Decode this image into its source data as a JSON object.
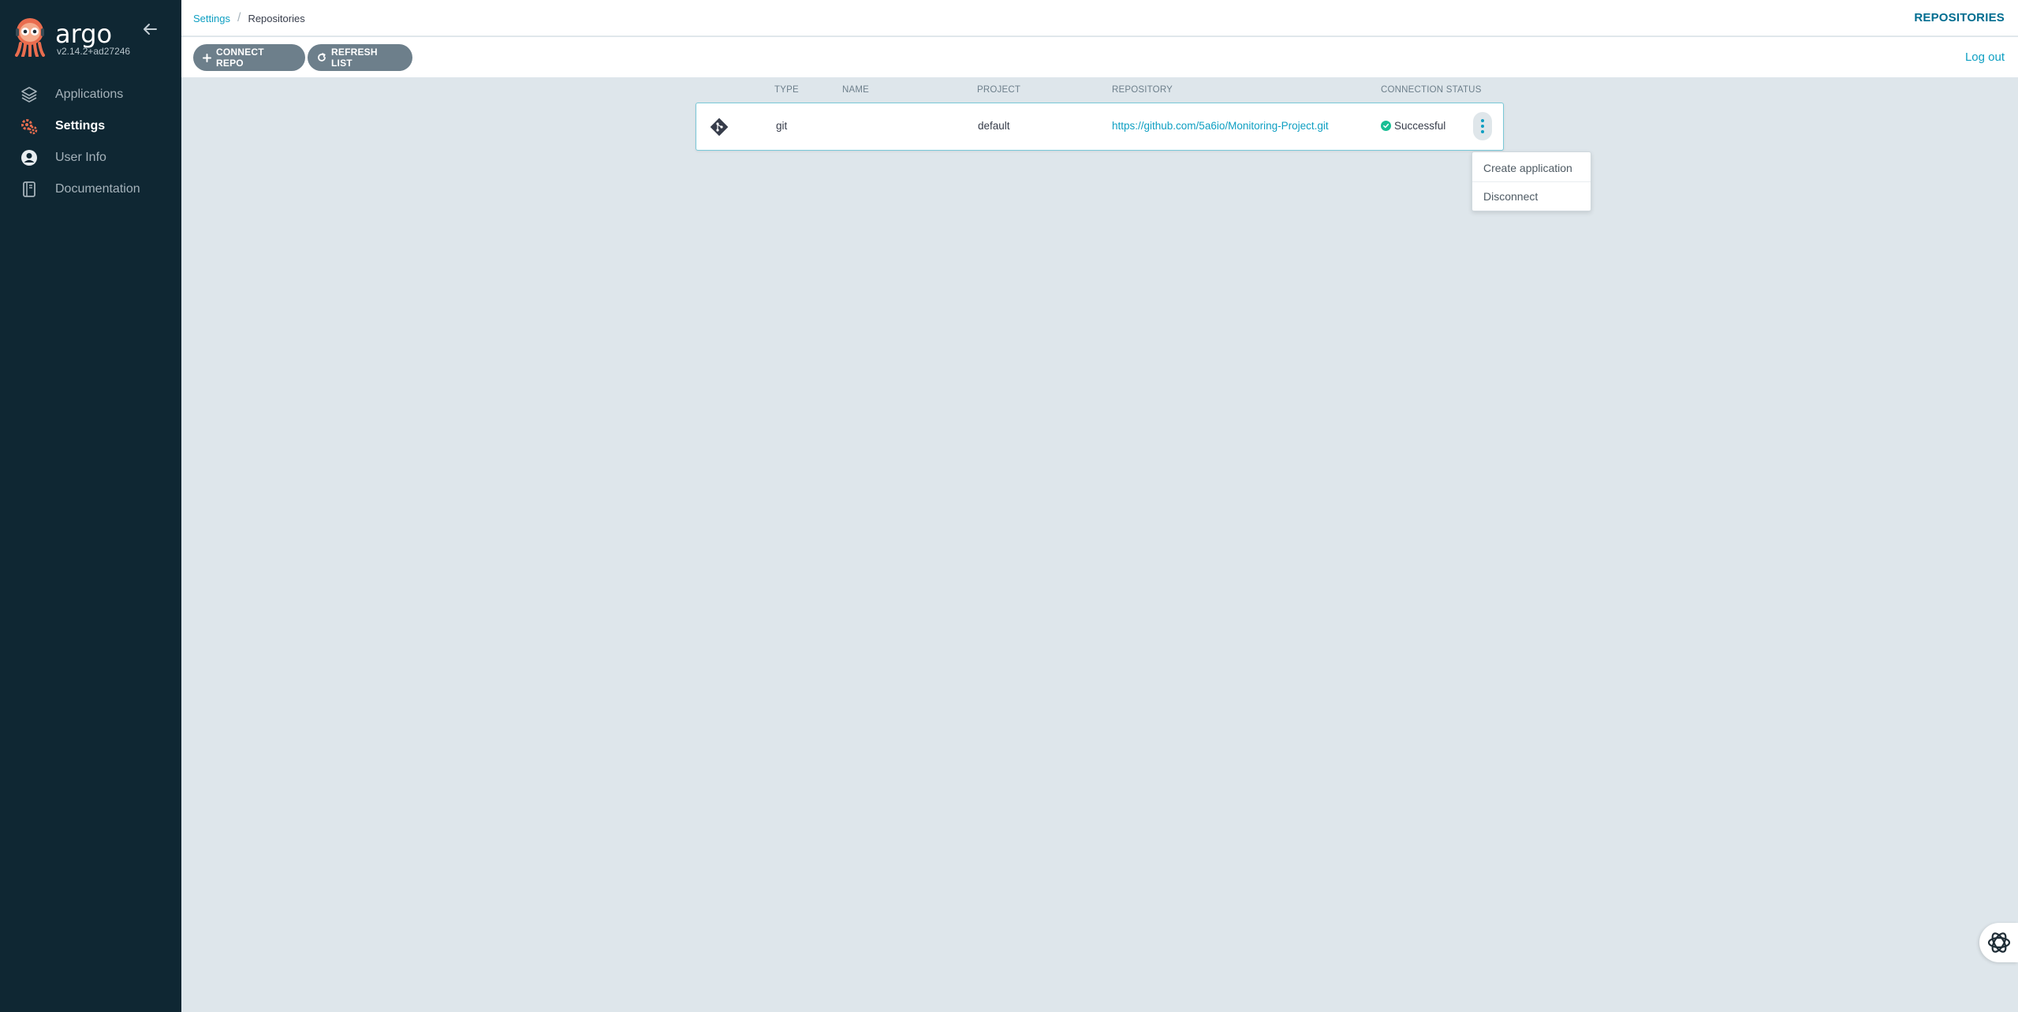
{
  "sidebar": {
    "logo_text": "argo",
    "version": "v2.14.2+ad27246",
    "items": [
      {
        "label": "Applications",
        "icon": "layers-icon"
      },
      {
        "label": "Settings",
        "icon": "gear-icon",
        "active": true
      },
      {
        "label": "User Info",
        "icon": "user-circle-icon"
      },
      {
        "label": "Documentation",
        "icon": "book-icon"
      }
    ]
  },
  "header": {
    "breadcrumb": [
      "Settings",
      "Repositories"
    ],
    "title": "REPOSITORIES"
  },
  "toolbar": {
    "connect_label": "CONNECT REPO",
    "refresh_label": "REFRESH LIST",
    "logout_label": "Log out"
  },
  "table": {
    "columns": [
      "TYPE",
      "NAME",
      "PROJECT",
      "REPOSITORY",
      "CONNECTION STATUS"
    ],
    "rows": [
      {
        "type": "git",
        "name": "",
        "project": "default",
        "repository": "https://github.com/5a6io/Monitoring-Project.git",
        "status": "Successful"
      }
    ]
  },
  "menu": {
    "items": [
      "Create application",
      "Disconnect"
    ]
  },
  "colors": {
    "sidebar_bg": "#0f2733",
    "accent": "#0e9fc2",
    "success": "#18be94",
    "button_bg": "#6d7f8b",
    "page_bg": "#dee6eb"
  }
}
